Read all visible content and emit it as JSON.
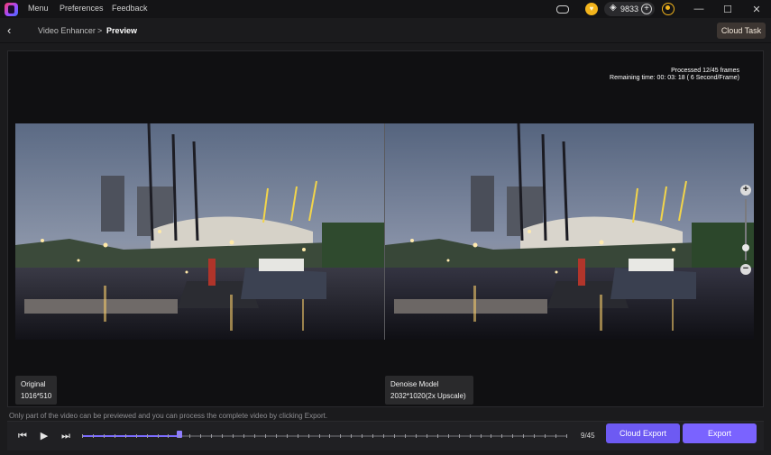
{
  "titlebar": {
    "menu": [
      "Menu",
      "Preferences",
      "Feedback"
    ],
    "credits": "9833",
    "window_controls": {
      "minimize": "—",
      "maximize": "☐",
      "close": "✕"
    }
  },
  "nav": {
    "back_icon": "‹",
    "breadcrumb": [
      "Video Enhancer",
      "Preview"
    ],
    "breadcrumb_sep": ">",
    "cloud_task": "Cloud Task"
  },
  "progress": {
    "processed": "Processed 12/45 frames",
    "remaining": "Remaining time: 00: 03: 18 ( 6 Second/Frame)"
  },
  "panes": {
    "left": {
      "title": "Original",
      "resolution": "1016*510"
    },
    "right": {
      "title": "Denoise Model",
      "resolution": "2032*1020(2x Upscale)"
    }
  },
  "zoom": {
    "plus": "+",
    "minus": "−",
    "level": 0.17
  },
  "notice": "Only part of the video can be previewed and you can process the complete video by clicking Export.",
  "playback": {
    "frame_current": 9,
    "frame_total": 45,
    "frame_label": "9/45",
    "prev_icon": "⏮",
    "play_icon": "▶",
    "next_icon": "⏭"
  },
  "actions": {
    "cloud_export": "Cloud Export",
    "export": "Export"
  },
  "colors": {
    "accent": "#7a63ff",
    "coin": "#f2b41c",
    "cloud_task_bg": "#3d3632"
  }
}
